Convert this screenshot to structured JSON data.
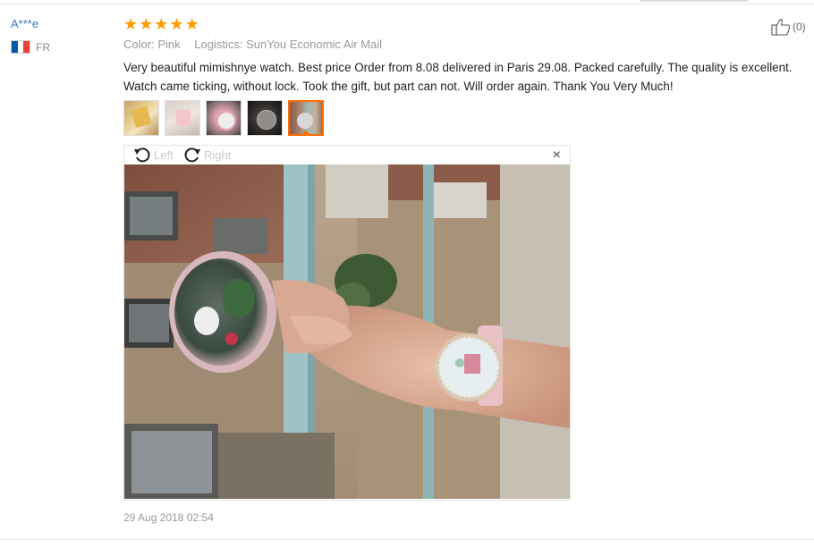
{
  "reviewer": {
    "name": "A***e",
    "country_code": "FR",
    "flag_colors": [
      "#0055a4",
      "#ffffff",
      "#ef4135"
    ]
  },
  "review": {
    "rating": 5,
    "stars": [
      "★",
      "★",
      "★",
      "★",
      "★"
    ],
    "color_label": "Color:",
    "color_value": "Pink",
    "logistics_label": "Logistics:",
    "logistics_value": "SunYou Economic Air Mail",
    "text_line1": "Very beautiful mimishnye watch. Best price Order from 8.08 delivered in Paris 29.08. Packed carefully. The quality is excellent.",
    "text_line2": "Watch came ticking, without lock. Took the gift, but part can not. Will order again. Thank You Very Much!",
    "helpful_count": "(0)",
    "date": "29 Aug 2018 02:54"
  },
  "viewer": {
    "rotate_left_label": "Left",
    "rotate_right_label": "Right",
    "close_symbol": "×"
  },
  "thumbnails": [
    {
      "name": "photo-thumbnail-1",
      "active": false
    },
    {
      "name": "photo-thumbnail-2",
      "active": false
    },
    {
      "name": "photo-thumbnail-3",
      "active": false
    },
    {
      "name": "photo-thumbnail-4",
      "active": false
    },
    {
      "name": "photo-thumbnail-5",
      "active": true
    }
  ],
  "colors": {
    "accent": "#ff6a00",
    "star": "#ff9a00",
    "link": "#3b7bbf"
  }
}
